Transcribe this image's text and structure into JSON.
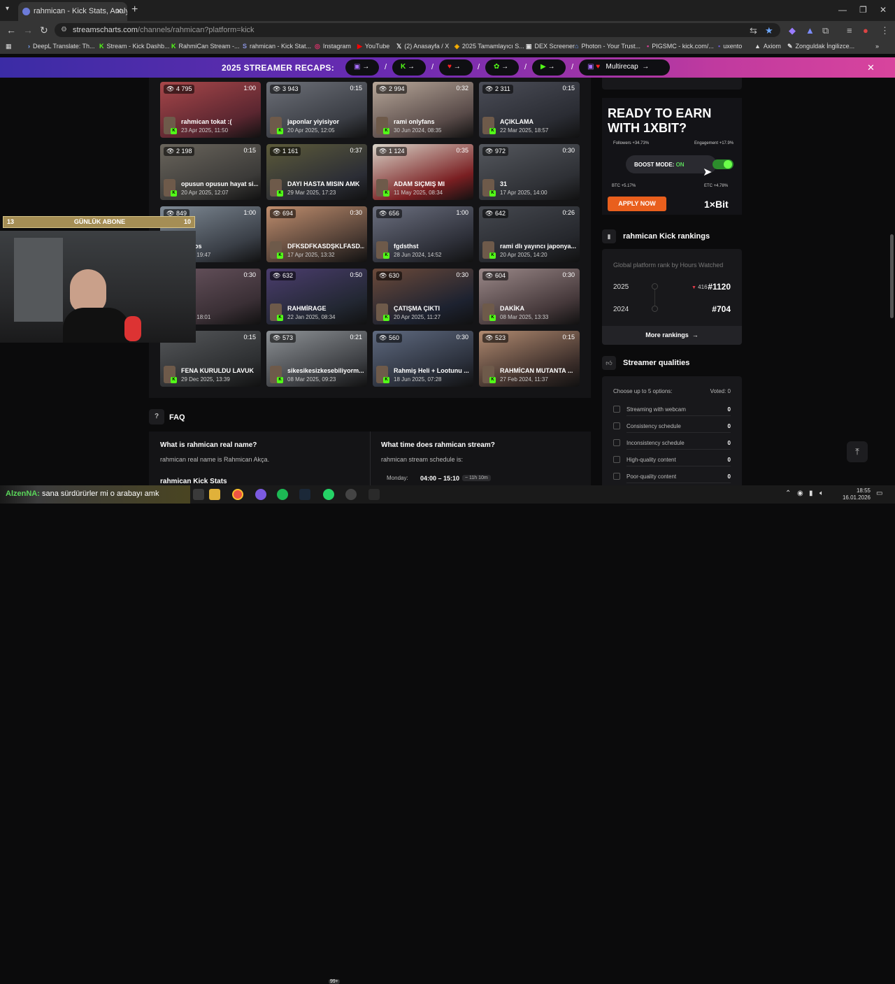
{
  "browser": {
    "tab_title": "rahmican - Kick Stats, Analy",
    "url_host": "streamscharts.com",
    "url_path": "/channels/rahmican?platform=kick",
    "bookmarks": [
      "DeepL Translate: Th...",
      "Stream - Kick Dashb...",
      "RahmiCan Stream -...",
      "rahmican - Kick Stat...",
      "Instagram",
      "YouTube",
      "(2) Anasayfa / X",
      "2025 Tamamlayıcı S...",
      "DEX Screener",
      "Photon - Your Trust...",
      "PIGSMC - kick.com/...",
      "uxento",
      "Axiom",
      "Zonguldak İngilizce..."
    ]
  },
  "promo": {
    "title": "2025 STREAMER RECAPS:",
    "multirecap": "Multirecap"
  },
  "clips": [
    {
      "views": "4 795",
      "dur": "1:00",
      "title": "rahmican tokat :(",
      "date": "23 Apr 2025, 11:50"
    },
    {
      "views": "3 943",
      "dur": "0:15",
      "title": "japonlar yiyisiyor",
      "date": "20 Apr 2025, 12:05"
    },
    {
      "views": "2 994",
      "dur": "0:32",
      "title": "rami onlyfans",
      "date": "30 Jun 2024, 08:35"
    },
    {
      "views": "2 311",
      "dur": "0:15",
      "title": "AÇIKLAMA",
      "date": "22 Mar 2025, 18:57"
    },
    {
      "views": "2 198",
      "dur": "0:15",
      "title": "opusun opusun hayat si...",
      "date": "20 Apr 2025, 12:07"
    },
    {
      "views": "1 161",
      "dur": "0:37",
      "title": "DAYI HASTA MISIN AMK",
      "date": "29 Mar 2025, 17:23"
    },
    {
      "views": "1 124",
      "dur": "0:35",
      "title": "ADAM SIÇMIŞ MI",
      "date": "11 May 2025, 08:34"
    },
    {
      "views": "972",
      "dur": "0:30",
      "title": "31",
      "date": "17 Apr 2025, 14:00"
    },
    {
      "views": "849",
      "dur": "1:00",
      "title": "sarhos",
      "date": "2025, 19:47"
    },
    {
      "views": "694",
      "dur": "0:30",
      "title": "DFKSDFKASDŞKLFASD...",
      "date": "17 Apr 2025, 13:32"
    },
    {
      "views": "656",
      "dur": "1:00",
      "title": "fgdsthst",
      "date": "28 Jun 2024, 14:52"
    },
    {
      "views": "642",
      "dur": "0:26",
      "title": "rami dlı yayıncı japonya...",
      "date": "20 Apr 2025, 14:20"
    },
    {
      "views": "",
      "dur": "0:30",
      "title": "",
      "date": "2025, 18:01"
    },
    {
      "views": "632",
      "dur": "0:50",
      "title": "RAHMİRAGE",
      "date": "22 Jan 2025, 08:34"
    },
    {
      "views": "630",
      "dur": "0:30",
      "title": "ÇATIŞMA ÇIKTI",
      "date": "20 Apr 2025, 11:27"
    },
    {
      "views": "604",
      "dur": "0:30",
      "title": "DAKİKA",
      "date": "08 Mar 2025, 13:33"
    },
    {
      "views": "",
      "dur": "0:15",
      "title": "FENA KURULDU LAVUK",
      "date": "29 Dec 2025, 13:39"
    },
    {
      "views": "573",
      "dur": "0:21",
      "title": "sikesikesizkesebiliyorm...",
      "date": "08 Mar 2025, 09:23"
    },
    {
      "views": "560",
      "dur": "0:30",
      "title": "Rahmiş Heli + Lootunu ...",
      "date": "18 Jun 2025, 07:28"
    },
    {
      "views": "523",
      "dur": "0:15",
      "title": "RAHMİCAN MUTANTA ...",
      "date": "27 Feb 2024, 11:37"
    }
  ],
  "faq": {
    "title": "FAQ",
    "q1": "What is rahmican real name?",
    "a1": "rahmican real name is Rahmican Akça.",
    "q2": "What time does rahmican stream?",
    "a2": "rahmican stream schedule is:",
    "q3": "rahmican Kick Stats",
    "sched_day": "Monday:",
    "sched_time": "04:00 – 15:10",
    "sched_dur": "~ 11h 10m"
  },
  "ad": {
    "headline_1": "READY TO EARN",
    "headline_2": "WITH 1XBIT?",
    "followers": "Followers +34.73%",
    "engagement": "Engagement +17.9%",
    "boost_label": "BOOST MODE:",
    "boost_state": "ON",
    "btc": "BTC +5.17%",
    "etc": "ETC +4.78%",
    "apply": "APPLY NOW",
    "brand": "1×Bit"
  },
  "rankings": {
    "title": "rahmican Kick rankings",
    "subtitle": "Global platform rank by Hours Watched",
    "rows": [
      {
        "year": "2025",
        "change": "416",
        "rank": "#1120"
      },
      {
        "year": "2024",
        "change": "",
        "rank": "#704"
      }
    ],
    "more": "More rankings"
  },
  "qualities": {
    "title": "Streamer qualities",
    "choose": "Choose up to 5 options:",
    "voted": "Voted: 0",
    "items": [
      {
        "label": "Streaming with webcam",
        "count": "0"
      },
      {
        "label": "Consistency schedule",
        "count": "0"
      },
      {
        "label": "Inconsistency schedule",
        "count": "0"
      },
      {
        "label": "High-quality content",
        "count": "0"
      },
      {
        "label": "Poor-quality content",
        "count": "0"
      }
    ]
  },
  "overlay": {
    "goal_current": "13",
    "goal_label": "GÜNLÜK ABONE",
    "goal_target": "10",
    "chat_user": "AlzenNA:",
    "chat_msg": "sana sürdürürler mi o arabayı amk"
  },
  "taskbar": {
    "badge": "99+",
    "time": "18:55",
    "date": "16.01.2026"
  },
  "colors": {
    "kick_green": "#53fc18",
    "accent_orange": "#e95f1d",
    "promo_purple": "#6d2bb2",
    "page_bg": "#0b0b0c"
  }
}
